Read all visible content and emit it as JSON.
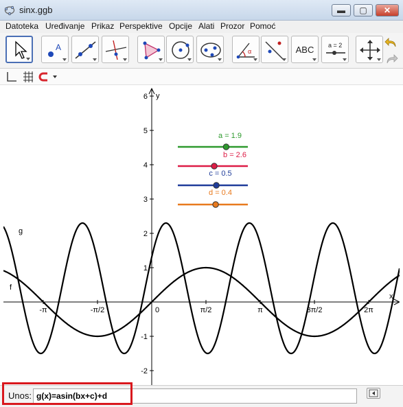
{
  "window": {
    "title": "sinx.ggb",
    "minimize": "▬",
    "maximize": "▢",
    "close": "✕"
  },
  "menu": [
    "Datoteka",
    "Uređivanje",
    "Prikaz",
    "Perspektive",
    "Opcije",
    "Alati",
    "Prozor",
    "Pomoć"
  ],
  "toolbar": {
    "tools": [
      "move",
      "point",
      "line",
      "perpendicular-line",
      "polygon",
      "circle",
      "conic",
      "angle",
      "reflect",
      "text",
      "slider",
      "move-graphics"
    ],
    "text_tool_label": "ABC",
    "slider_tool_label": "a = 2"
  },
  "graphics": {
    "y_axis_label": "y",
    "x_axis_label": "x",
    "x_ticks": [
      "-π",
      "-π/2",
      "0",
      "π/2",
      "π",
      "3π/2",
      "2π"
    ],
    "y_ticks": [
      "6",
      "5",
      "4",
      "3",
      "2",
      "1",
      "-1",
      "-2"
    ],
    "function_labels": {
      "g": "g",
      "f": "f"
    },
    "sliders": [
      {
        "label": "a = 1.9",
        "value": 1.9,
        "color": "#2e9a2e"
      },
      {
        "label": "b = 2.6",
        "value": 2.6,
        "color": "#dd1c46"
      },
      {
        "label": "c = 0.5",
        "value": 0.5,
        "color": "#1f3c9a"
      },
      {
        "label": "d = 0.4",
        "value": 0.4,
        "color": "#e87a1e"
      }
    ]
  },
  "input": {
    "label": "Unos:",
    "value": "g(x)=asin(bx+c)+d"
  },
  "colors": {
    "highlight": "#d9181d",
    "curve": "#000000",
    "axis": "#000000"
  }
}
